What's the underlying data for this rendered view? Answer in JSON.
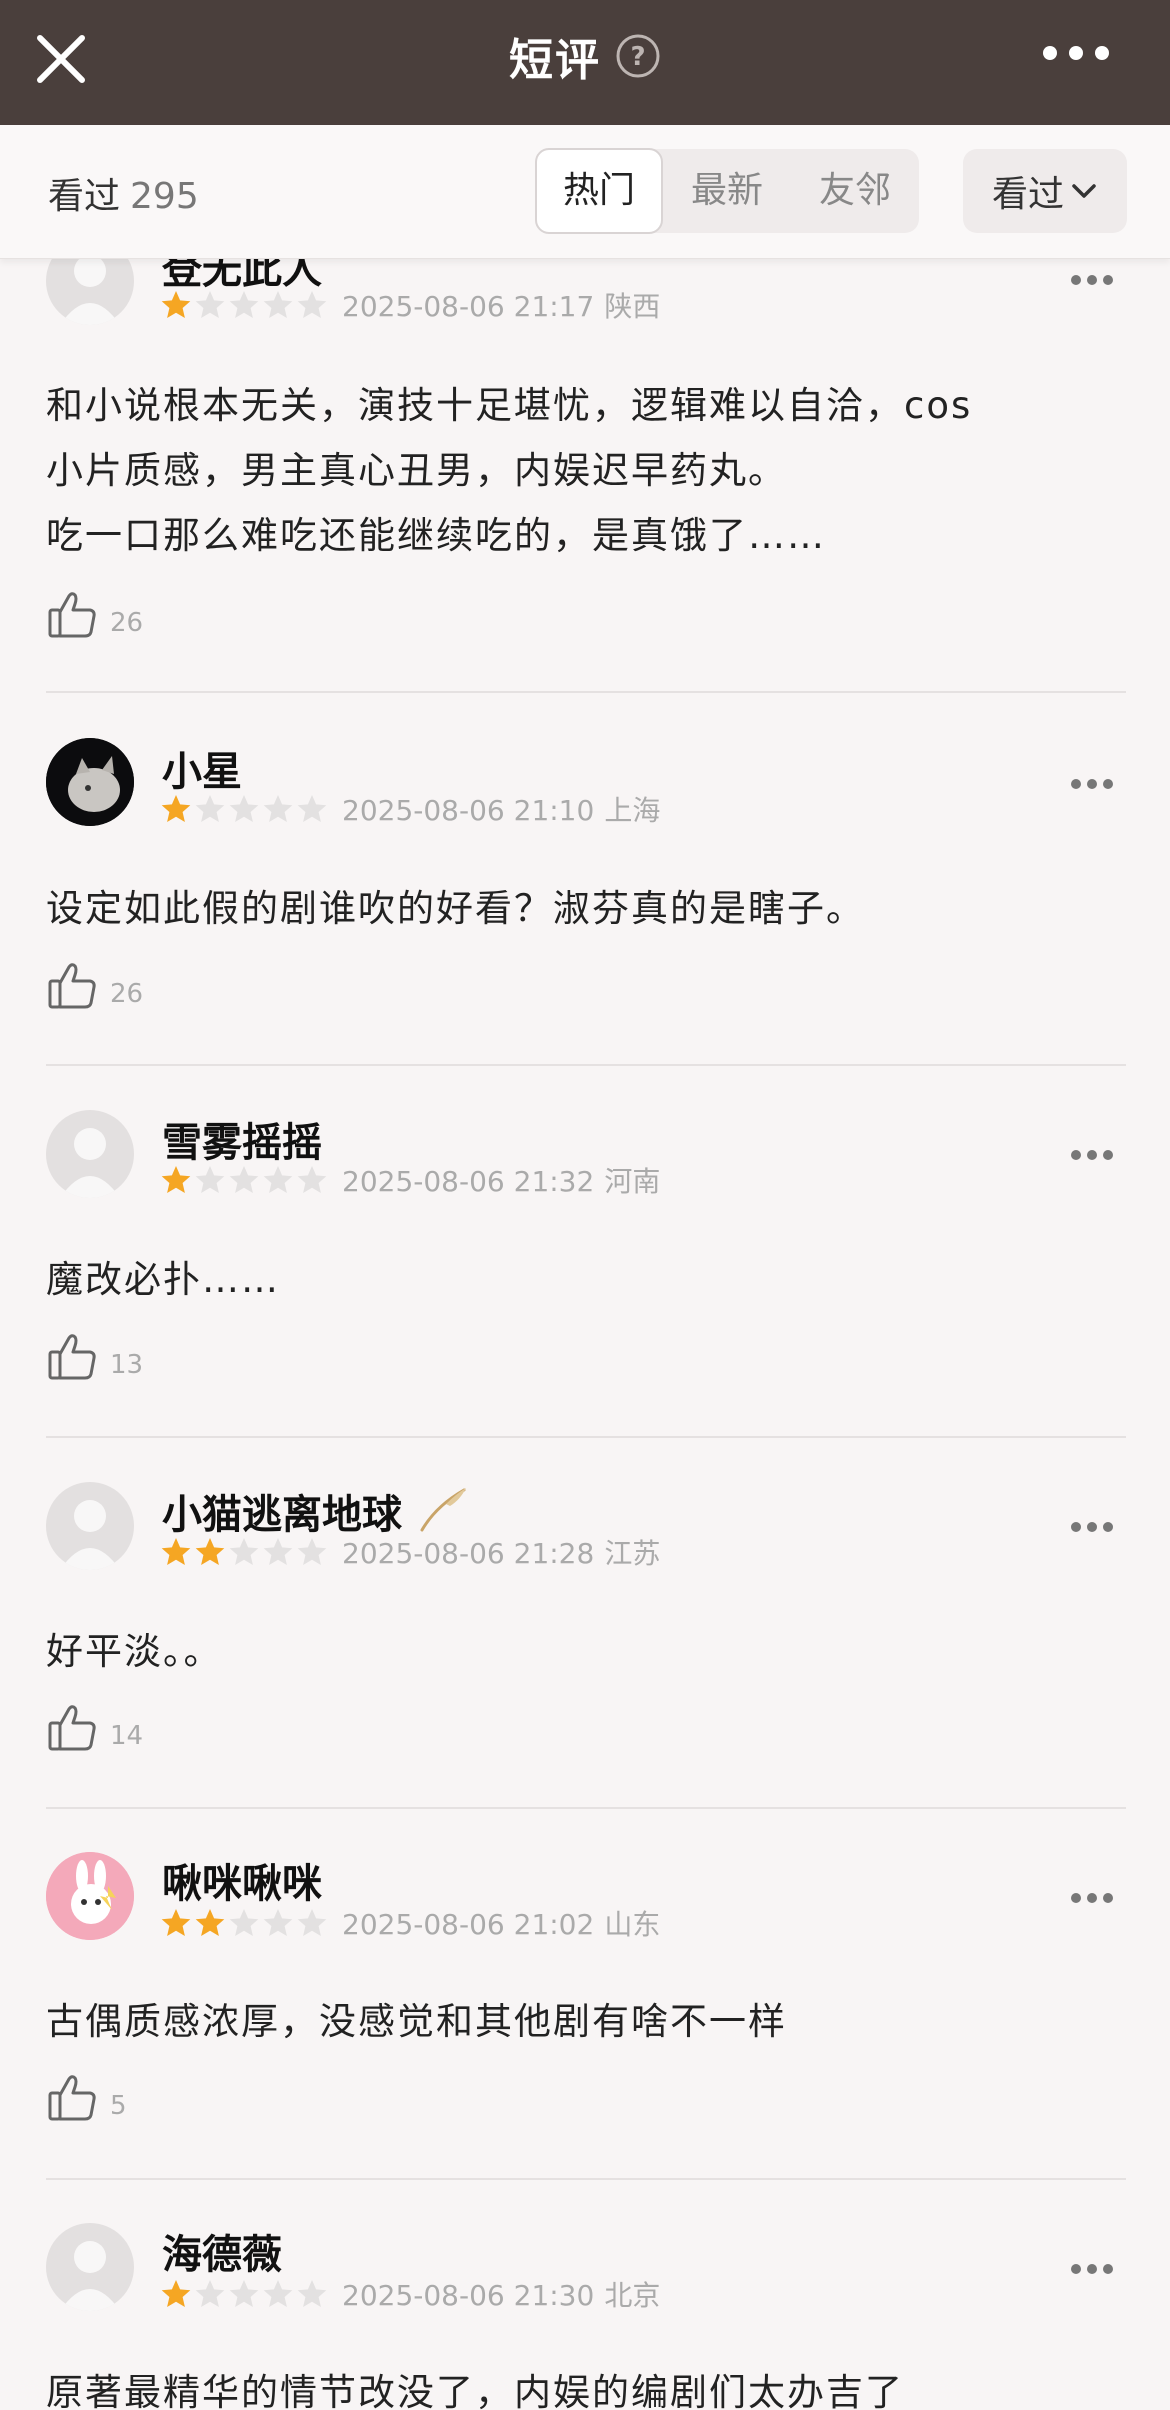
{
  "header": {
    "title": "短评",
    "icons": {
      "close": "close-icon",
      "help": "help-icon",
      "more": "more-icon"
    }
  },
  "subbar": {
    "seen_label": "看过",
    "seen_count": "295",
    "tabs": [
      {
        "label": "热门",
        "active": true
      },
      {
        "label": "最新",
        "active": false
      },
      {
        "label": "友邻",
        "active": false
      }
    ],
    "filter_label": "看过"
  },
  "colors": {
    "header_bg": "#4a3f3c",
    "star_filled": "#f5a623",
    "star_empty": "#e3e1e1",
    "page_bg": "#f8f5f5"
  },
  "reviews": [
    {
      "user": "登无此人",
      "rating": 1,
      "date": "2025-08-06 21:17",
      "location": "陕西",
      "lines": [
        "和小说根本无关，演技十足堪忧，逻辑难以自洽，cos",
        "小片质感，男主真心丑男，内娱迟早药丸。",
        "吃一口那么难吃还能继续吃的，是真饿了……"
      ],
      "likes": "26",
      "avatar": "default-avatar"
    },
    {
      "user": "小星",
      "rating": 1,
      "date": "2025-08-06 21:10",
      "location": "上海",
      "lines": [
        "设定如此假的剧谁吹的好看？淑芬真的是瞎子。"
      ],
      "likes": "26",
      "avatar": "cat-avatar"
    },
    {
      "user": "雪雾摇摇",
      "rating": 1,
      "date": "2025-08-06 21:32",
      "location": "河南",
      "lines": [
        "魔改必扑……"
      ],
      "likes": "13",
      "avatar": "default-avatar"
    },
    {
      "user": "小猫逃离地球",
      "rating": 2,
      "date": "2025-08-06 21:28",
      "location": "江苏",
      "lines": [
        "好平淡。。"
      ],
      "likes": "14",
      "avatar": "default-avatar",
      "badge": "feather-icon"
    },
    {
      "user": "啾咪啾咪",
      "rating": 2,
      "date": "2025-08-06 21:02",
      "location": "山东",
      "lines": [
        "古偶质感浓厚，没感觉和其他剧有啥不一样"
      ],
      "likes": "5",
      "avatar": "bunny-avatar"
    },
    {
      "user": "海德薇",
      "rating": 1,
      "date": "2025-08-06 21:30",
      "location": "北京",
      "lines": [
        "原著最精华的情节改没了，内娱的编剧们太办吉了"
      ],
      "likes": "",
      "avatar": "default-avatar"
    }
  ]
}
